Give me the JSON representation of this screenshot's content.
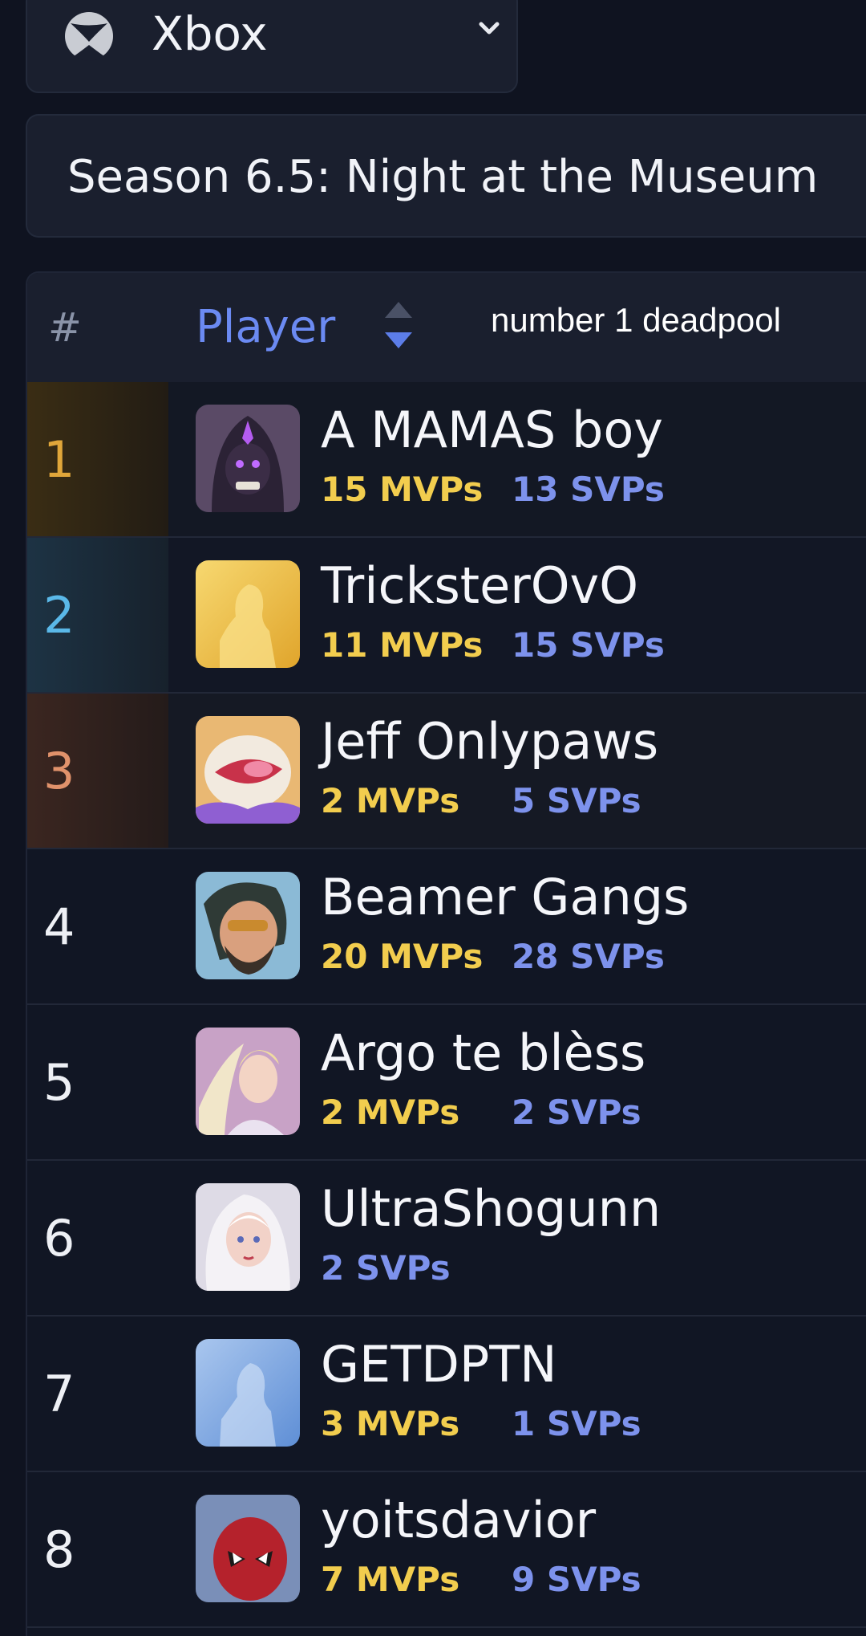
{
  "platform": {
    "label": "Xbox",
    "icon": "xbox-logo-icon"
  },
  "season": {
    "label": "Season 6.5: Night at the Museum"
  },
  "table": {
    "headers": {
      "rank": "#",
      "player": "Player"
    },
    "overlay_text": "number 1 deadpool",
    "rows": [
      {
        "rank": "1",
        "name": "A MAMAS boy",
        "mvps": "15 MVPs",
        "svps": "13 SVPs",
        "avatar": "hooded-hero-avatar"
      },
      {
        "rank": "2",
        "name": "TricksterOvO",
        "mvps": "11 MVPs",
        "svps": "15 SVPs",
        "avatar": "gold-silhouette-avatar"
      },
      {
        "rank": "3",
        "name": "Jeff Onlypaws",
        "mvps": "2 MVPs",
        "svps": "5 SVPs",
        "avatar": "jeff-shark-avatar"
      },
      {
        "rank": "4",
        "name": "Beamer Gangs",
        "mvps": "20 MVPs",
        "svps": "28 SVPs",
        "avatar": "bearded-hero-avatar"
      },
      {
        "rank": "5",
        "name": "Argo te blèss",
        "mvps": "2 MVPs",
        "svps": "2 SVPs",
        "avatar": "winged-heroine-avatar"
      },
      {
        "rank": "6",
        "name": "UltraShogunn",
        "mvps": "",
        "svps": "2 SVPs",
        "avatar": "white-haired-heroine-avatar"
      },
      {
        "rank": "7",
        "name": "GETDPTN",
        "mvps": "3 MVPs",
        "svps": "1 SVPs",
        "avatar": "blue-silhouette-avatar"
      },
      {
        "rank": "8",
        "name": "yoitsdavior",
        "mvps": "7 MVPs",
        "svps": "9 SVPs",
        "avatar": "red-masked-hero-avatar"
      }
    ]
  },
  "colors": {
    "background": "#0f1320",
    "mvp": "#f2cd4e",
    "svp": "#7d92ec",
    "header_accent": "#6b8af2",
    "rank1": "#e0a63a",
    "rank2": "#5ab8e8",
    "rank3": "#e0926b"
  }
}
